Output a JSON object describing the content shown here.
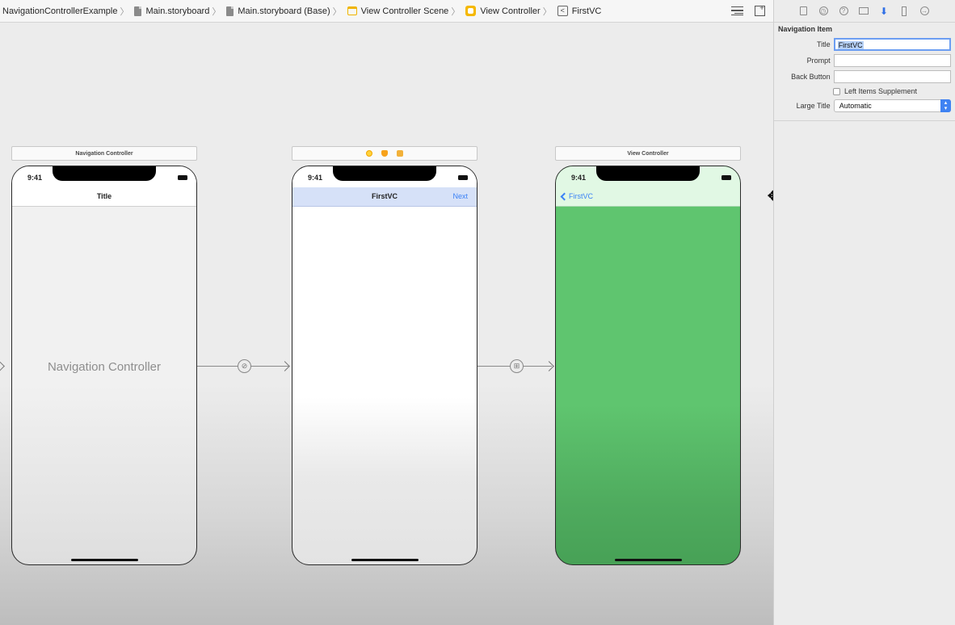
{
  "jumpbar": {
    "crumbs": [
      {
        "label": "NavigationControllerExample",
        "icon": "none"
      },
      {
        "label": "Main.storyboard",
        "icon": "storyboard-file-icon"
      },
      {
        "label": "Main.storyboard (Base)",
        "icon": "storyboard-file-icon"
      },
      {
        "label": "View Controller Scene",
        "icon": "scene-icon"
      },
      {
        "label": "View Controller",
        "icon": "view-controller-icon"
      },
      {
        "label": "FirstVC",
        "icon": "navigation-item-icon"
      }
    ],
    "separator": "〉",
    "nav_item_glyph": "<"
  },
  "canvas": {
    "nav_scene": {
      "header": "Navigation Controller",
      "time": "9:41",
      "nav_title": "Title",
      "center_label": "Navigation Controller"
    },
    "first_scene": {
      "time": "9:41",
      "nav_title": "FirstVC",
      "right_button": "Next"
    },
    "green_scene": {
      "header": "View Controller",
      "time": "9:41",
      "back_button": "FirstVC"
    },
    "segue_icons": {
      "root": "⊘",
      "show": "⊞"
    }
  },
  "inspector": {
    "tabs": [
      "file-inspector-icon",
      "history-inspector-icon",
      "help-inspector-icon",
      "identity-inspector-icon",
      "attributes-inspector-icon",
      "size-inspector-icon",
      "connections-inspector-icon"
    ],
    "section_title": "Navigation Item",
    "title_label": "Title",
    "title_value": "FirstVC",
    "prompt_label": "Prompt",
    "prompt_value": "",
    "back_button_label": "Back Button",
    "back_button_value": "",
    "left_items_label": "Left Items Supplement",
    "large_title_label": "Large Title",
    "large_title_value": "Automatic"
  },
  "colors": {
    "accent": "#3b82f6",
    "green_view": "#5fc56f",
    "selected_navbar": "#d6e1f8"
  }
}
